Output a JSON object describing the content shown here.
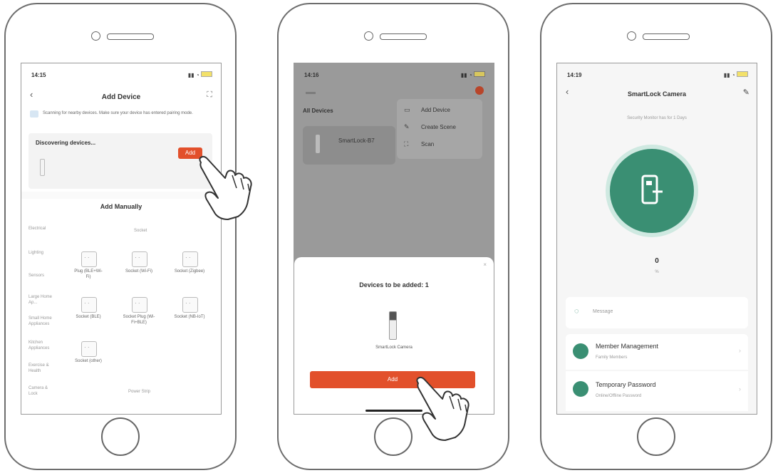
{
  "screen1": {
    "status_time": "14:15",
    "title": "Add Device",
    "info_text": "Scanning for nearby devices. Make sure your device has entered pairing mode.",
    "discovering_label": "Discovering devices...",
    "add_button": "Add",
    "add_manually": "Add Manually",
    "categories": [
      "Electrical",
      "Lighting",
      "Sensors",
      "Large Home Ap...",
      "Small Home Appliances",
      "Kitchen Appliances",
      "Exercise & Health",
      "Camera & Lock"
    ],
    "section_right": "Socket",
    "section_bottom": "Power Strip",
    "tiles": [
      {
        "label": "Plug (BLE+Wi-Fi)"
      },
      {
        "label": "Socket (Wi-Fi)"
      },
      {
        "label": "Socket (Zigbee)"
      },
      {
        "label": "Socket (BLE)"
      },
      {
        "label": "Socket Plug (Wi-Fi+BLE)"
      },
      {
        "label": "Socket (NB-IoT)"
      },
      {
        "label": "Socket (other)"
      }
    ]
  },
  "screen2": {
    "status_time": "14:16",
    "all_devices": "All Devices",
    "device_name": "SmartLock-B7",
    "menu": [
      {
        "label": "Add Device",
        "icon": "monitor-icon"
      },
      {
        "label": "Create Scene",
        "icon": "edit-icon"
      },
      {
        "label": "Scan",
        "icon": "scan-icon"
      }
    ],
    "sheet_title": "Devices to be added: 1",
    "sheet_device": "SmartLock Camera",
    "add_button": "Add"
  },
  "screen3": {
    "status_time": "14:19",
    "title": "SmartLock Camera",
    "remain_text": "Security Monitor has for 1 Days",
    "battery_value": "0",
    "battery_unit": "%",
    "message_label": "Message",
    "items": [
      {
        "title": "Member Management",
        "subtitle": "Family Members"
      },
      {
        "title": "Temporary Password",
        "subtitle": "Online/Offline Password"
      }
    ]
  },
  "colors": {
    "accent": "#e2502b",
    "lock_green": "#3a8f73",
    "lock_ring": "#cfe9e1"
  }
}
